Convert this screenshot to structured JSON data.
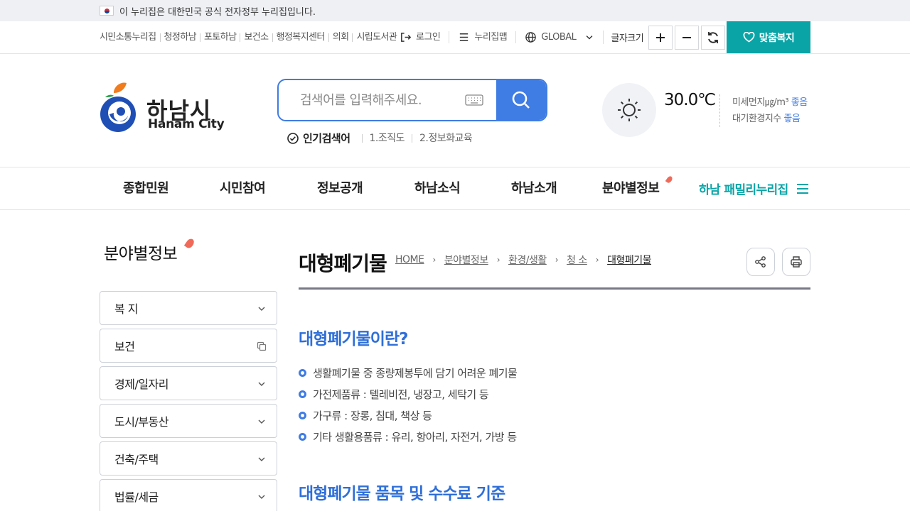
{
  "gov_banner": {
    "text": "이 누리집은 대한민국 공식 전자정부 누리집입니다."
  },
  "site_links": [
    "시민소통누리집",
    "청정하남",
    "포토하남",
    "보건소",
    "행정복지센터",
    "의회",
    "시립도서관"
  ],
  "utility": {
    "login": "로그인",
    "sitemap": "누리집맵",
    "global": "GLOBAL",
    "font_size": "글자크기",
    "custom_welfare": "맞춤복지"
  },
  "logo": {
    "ko": "하남시",
    "en": "Hanam City"
  },
  "search": {
    "placeholder": "검색어를 입력해주세요.",
    "popular_label": "인기검색어",
    "keywords": [
      "1.조직도",
      "2.정보화교육"
    ]
  },
  "weather": {
    "temperature": "30.0℃",
    "dust_label": "미세먼지㎍/m³",
    "dust_status": "좋음",
    "aqi_label": "대기환경지수",
    "aqi_status": "좋음"
  },
  "gnb": {
    "items": [
      "종합민원",
      "시민참여",
      "정보공개",
      "하남소식",
      "하남소개",
      "분야별정보"
    ],
    "family": "하남 패밀리누리집"
  },
  "side": {
    "title": "분야별정보",
    "items": [
      "복 지",
      "보건",
      "경제/일자리",
      "도시/부동산",
      "건축/주택",
      "법률/세금"
    ]
  },
  "content": {
    "title": "대형폐기물",
    "breadcrumb": [
      "HOME",
      "분야별정보",
      "환경/생활",
      "청 소",
      "대형폐기물"
    ],
    "section1": "대형폐기물이란?",
    "bullets": [
      "생활폐기물 중 종량제봉투에 담기 어려운 폐기물",
      "가전제품류 : 텔레비전, 냉장고, 세탁기 등",
      "가구류 : 장롱, 침대, 책상 등",
      "기타 생활용품류 : 유리, 항아리, 자전거, 가방 등"
    ],
    "section2": "대형폐기물 품목 및 수수료 기준"
  },
  "colors": {
    "accent_blue": "#3f7ce3",
    "teal": "#0aa4a7",
    "dot_red": "#f06a5a"
  }
}
